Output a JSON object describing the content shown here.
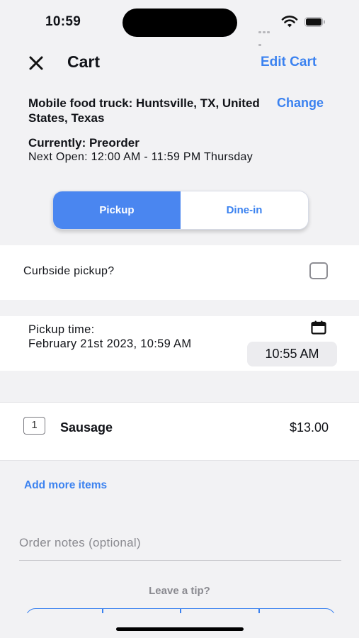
{
  "status_bar": {
    "time": "10:59"
  },
  "header": {
    "title": "Cart",
    "edit_label": "Edit Cart"
  },
  "location": {
    "name": "Mobile food truck: Huntsville, TX, United States, Texas",
    "change_label": "Change",
    "currently": "Currently: Preorder",
    "next_open": "Next Open: 12:00 AM - 11:59 PM Thursday"
  },
  "order_type": {
    "options": [
      "Pickup",
      "Dine-in"
    ],
    "selected": "Pickup"
  },
  "curbside": {
    "label": "Curbside pickup?",
    "checked": false
  },
  "pickup_time": {
    "label": "Pickup time:",
    "date": "February 21st 2023, 10:59 AM",
    "selected_time": "10:55 AM"
  },
  "cart_items": [
    {
      "quantity": "1",
      "name": "Sausage",
      "price": "$13.00"
    }
  ],
  "add_more_label": "Add more items",
  "order_notes": {
    "placeholder": "Order notes (optional)",
    "value": ""
  },
  "tip": {
    "heading": "Leave a tip?"
  },
  "colors": {
    "accent": "#3b82f0",
    "accent_fill": "#4a86f0",
    "background": "#f2f2f4"
  }
}
